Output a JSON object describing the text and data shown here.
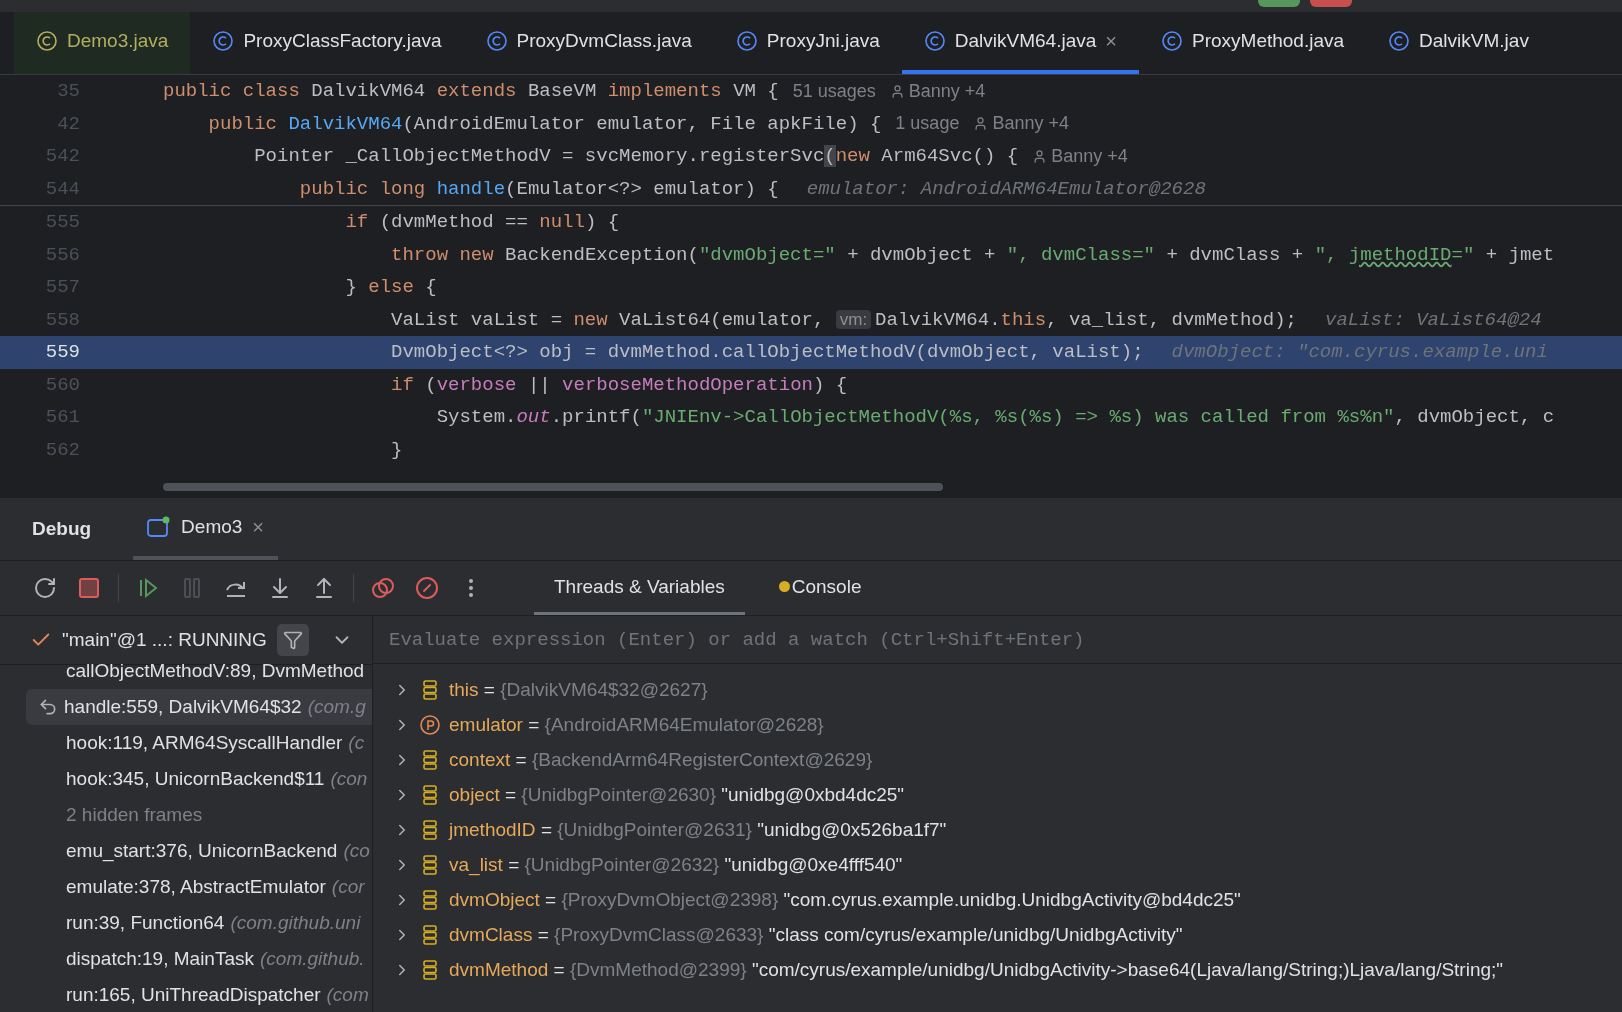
{
  "editor_tabs": [
    {
      "label": "Demo3.java",
      "selected": false,
      "closable": false,
      "color": "#b3ae60"
    },
    {
      "label": "ProxyClassFactory.java",
      "selected": false,
      "closable": false,
      "color": "#dfe1e5"
    },
    {
      "label": "ProxyDvmClass.java",
      "selected": false,
      "closable": false,
      "color": "#dfe1e5"
    },
    {
      "label": "ProxyJni.java",
      "selected": false,
      "closable": false,
      "color": "#dfe1e5"
    },
    {
      "label": "DalvikVM64.java",
      "selected": true,
      "closable": true,
      "close": "×",
      "color": "#dfe1e5"
    },
    {
      "label": "ProxyMethod.java",
      "selected": false,
      "closable": false,
      "color": "#dfe1e5"
    },
    {
      "label": "DalvikVM.jav",
      "selected": false,
      "closable": false,
      "color": "#dfe1e5"
    }
  ],
  "sticky_lines": [
    {
      "number": "35",
      "tokens": [
        {
          "kind": "kw",
          "text": "public class "
        },
        {
          "kind": "plain",
          "text": "DalvikVM64 "
        },
        {
          "kind": "kw",
          "text": "extends "
        },
        {
          "kind": "plain",
          "text": "BaseVM "
        },
        {
          "kind": "kw",
          "text": "implements "
        },
        {
          "kind": "plain",
          "text": "VM {"
        }
      ],
      "hints": [
        {
          "kind": "usages",
          "text": "51 usages"
        },
        {
          "kind": "author",
          "text": "Banny +4"
        }
      ]
    },
    {
      "number": "42",
      "tokens": [
        {
          "kind": "kw",
          "text": "    public "
        },
        {
          "kind": "fn",
          "text": "DalvikVM64"
        },
        {
          "kind": "plain",
          "text": "(AndroidEmulator emulator, File apkFile) {"
        }
      ],
      "hints": [
        {
          "kind": "usages",
          "text": "1 usage"
        },
        {
          "kind": "author",
          "text": "Banny +4"
        }
      ]
    },
    {
      "number": "542",
      "tokens": [
        {
          "kind": "plain",
          "text": "        Pointer _CallObjectMethodV = svcMemory.registerSvc"
        },
        {
          "kind": "match",
          "text": "("
        },
        {
          "kind": "kw",
          "text": "new "
        },
        {
          "kind": "plain",
          "text": "Arm64Svc() {"
        }
      ],
      "hints": [
        {
          "kind": "author",
          "text": "Banny +4"
        }
      ]
    },
    {
      "number": "544",
      "tokens": [
        {
          "kind": "kw",
          "text": "            public long "
        },
        {
          "kind": "fn",
          "text": "handle"
        },
        {
          "kind": "plain",
          "text": "(Emulator<?> emulator) {"
        }
      ],
      "hints": [
        {
          "kind": "value",
          "text": "emulator: AndroidARM64Emulator@2628"
        }
      ]
    }
  ],
  "code_lines": [
    {
      "number": "555",
      "current": false,
      "tokens": [
        {
          "kind": "kw",
          "text": "                if "
        },
        {
          "kind": "plain",
          "text": "(dvmMethod == "
        },
        {
          "kind": "kw",
          "text": "null"
        },
        {
          "kind": "plain",
          "text": ") {"
        }
      ]
    },
    {
      "number": "556",
      "current": false,
      "tokens": [
        {
          "kind": "kw",
          "text": "                    throw new "
        },
        {
          "kind": "plain",
          "text": "BackendException("
        },
        {
          "kind": "str",
          "text": "\"dvmObject=\""
        },
        {
          "kind": "plain",
          "text": " + dvmObject + "
        },
        {
          "kind": "str",
          "text": "\", dvmClass=\""
        },
        {
          "kind": "plain",
          "text": " + dvmClass + "
        },
        {
          "kind": "str",
          "text": "\", "
        },
        {
          "kind": "typo",
          "text": "jmethodID"
        },
        {
          "kind": "str",
          "text": "=\""
        },
        {
          "kind": "plain",
          "text": " + jmet"
        }
      ]
    },
    {
      "number": "557",
      "current": false,
      "tokens": [
        {
          "kind": "plain",
          "text": "                } "
        },
        {
          "kind": "kw",
          "text": "else "
        },
        {
          "kind": "plain",
          "text": "{"
        }
      ]
    },
    {
      "number": "558",
      "current": false,
      "tokens": [
        {
          "kind": "plain",
          "text": "                    VaList vaList = "
        },
        {
          "kind": "kw",
          "text": "new "
        },
        {
          "kind": "plain",
          "text": "VaList64(emulator, "
        },
        {
          "kind": "param",
          "text": "vm:"
        },
        {
          "kind": "plain",
          "text": "DalvikVM64."
        },
        {
          "kind": "kw",
          "text": "this"
        },
        {
          "kind": "plain",
          "text": ", va_list, dvmMethod);"
        }
      ],
      "hint": "vaList: VaList64@24"
    },
    {
      "number": "559",
      "current": true,
      "tokens": [
        {
          "kind": "plain",
          "text": "                    DvmObject<?> obj = dvmMethod.callObjectMethodV(dvmObject, vaList);"
        }
      ],
      "hint": "dvmObject: \"com.cyrus.example.uni"
    },
    {
      "number": "560",
      "current": false,
      "tokens": [
        {
          "kind": "kw",
          "text": "                    if "
        },
        {
          "kind": "plain",
          "text": "("
        },
        {
          "kind": "field",
          "text": "verbose"
        },
        {
          "kind": "plain",
          "text": " || "
        },
        {
          "kind": "field",
          "text": "verboseMethodOperation"
        },
        {
          "kind": "plain",
          "text": ") {"
        }
      ]
    },
    {
      "number": "561",
      "current": false,
      "tokens": [
        {
          "kind": "plain",
          "text": "                        System."
        },
        {
          "kind": "static",
          "text": "out"
        },
        {
          "kind": "plain",
          "text": ".printf("
        },
        {
          "kind": "str",
          "text": "\"JNIEnv->CallObjectMethodV(%s, %s(%s) => %s) was called from %s%n\""
        },
        {
          "kind": "plain",
          "text": ", dvmObject, c"
        }
      ]
    },
    {
      "number": "562",
      "current": false,
      "tokens": [
        {
          "kind": "plain",
          "text": "                    }"
        }
      ]
    }
  ],
  "debug": {
    "title": "Debug",
    "session_tab": {
      "label": "Demo3",
      "close": "×"
    },
    "toolbar": [
      {
        "kind": "rerun",
        "disabled": false
      },
      {
        "kind": "stop",
        "disabled": false
      },
      {
        "kind": "sep"
      },
      {
        "kind": "resume",
        "disabled": false
      },
      {
        "kind": "pause",
        "disabled": true
      },
      {
        "kind": "step-over",
        "disabled": false
      },
      {
        "kind": "step-into",
        "disabled": false
      },
      {
        "kind": "step-out",
        "disabled": false
      },
      {
        "kind": "sep"
      },
      {
        "kind": "breakpoints",
        "disabled": false
      },
      {
        "kind": "mute",
        "disabled": false
      },
      {
        "kind": "more",
        "disabled": false
      }
    ],
    "view_tabs": [
      {
        "label": "Threads & Variables",
        "selected": true,
        "badge": false
      },
      {
        "label": "Console",
        "selected": false,
        "badge": true
      }
    ],
    "thread": "\"main\"@1 ...: RUNNING",
    "evaluate": {
      "placeholder": "Evaluate expression (Enter) or add a watch (Ctrl+Shift+Enter)"
    },
    "frames": [
      {
        "kind": "frame",
        "name": "callObjectMethodV:89, DvmMethod",
        "selected": false
      },
      {
        "kind": "frame",
        "name": "handle:559, DalvikVM64$32",
        "location": "(com.g",
        "selected": true
      },
      {
        "kind": "frame",
        "name": "hook:119, ARM64SyscallHandler",
        "location": "(c",
        "selected": false
      },
      {
        "kind": "frame",
        "name": "hook:345, UnicornBackend$11",
        "location": "(con",
        "selected": false
      },
      {
        "kind": "hidden",
        "name": "2 hidden frames",
        "selected": false
      },
      {
        "kind": "frame",
        "name": "emu_start:376, UnicornBackend",
        "location": "(co",
        "selected": false
      },
      {
        "kind": "frame",
        "name": "emulate:378, AbstractEmulator",
        "location": "(cor",
        "selected": false
      },
      {
        "kind": "frame",
        "name": "run:39, Function64",
        "location": "(com.github.uni",
        "selected": false
      },
      {
        "kind": "frame",
        "name": "dispatch:19, MainTask",
        "location": "(com.github.",
        "selected": false
      },
      {
        "kind": "frame",
        "name": "run:165, UniThreadDispatcher",
        "location": "(com",
        "selected": false
      }
    ],
    "variables": [
      {
        "kind": "field",
        "name": "this",
        "sep": "=",
        "type": "{DalvikVM64$32@2627}"
      },
      {
        "kind": "param",
        "name": "emulator",
        "sep": "=",
        "type": "{AndroidARM64Emulator@2628}"
      },
      {
        "kind": "field",
        "name": "context",
        "sep": "=",
        "type": "{BackendArm64RegisterContext@2629}"
      },
      {
        "kind": "field",
        "name": "object",
        "sep": "=",
        "type": "{UnidbgPointer@2630}",
        "value": "\"unidbg@0xbd4dc25\""
      },
      {
        "kind": "field",
        "name": "jmethodID",
        "sep": "=",
        "type": "{UnidbgPointer@2631}",
        "value": "\"unidbg@0x526ba1f7\""
      },
      {
        "kind": "field",
        "name": "va_list",
        "sep": "=",
        "type": "{UnidbgPointer@2632}",
        "value": "\"unidbg@0xe4fff540\""
      },
      {
        "kind": "field",
        "name": "dvmObject",
        "sep": "=",
        "type": "{ProxyDvmObject@2398}",
        "value": "\"com.cyrus.example.unidbg.UnidbgActivity@bd4dc25\""
      },
      {
        "kind": "field",
        "name": "dvmClass",
        "sep": "=",
        "type": "{ProxyDvmClass@2633}",
        "value": "\"class com/cyrus/example/unidbg/UnidbgActivity\""
      },
      {
        "kind": "field",
        "name": "dvmMethod",
        "sep": "=",
        "type": "{DvmMethod@2399}",
        "value": "\"com/cyrus/example/unidbg/UnidbgActivity->base64(Ljava/lang/String;)Ljava/lang/String;\""
      }
    ]
  }
}
